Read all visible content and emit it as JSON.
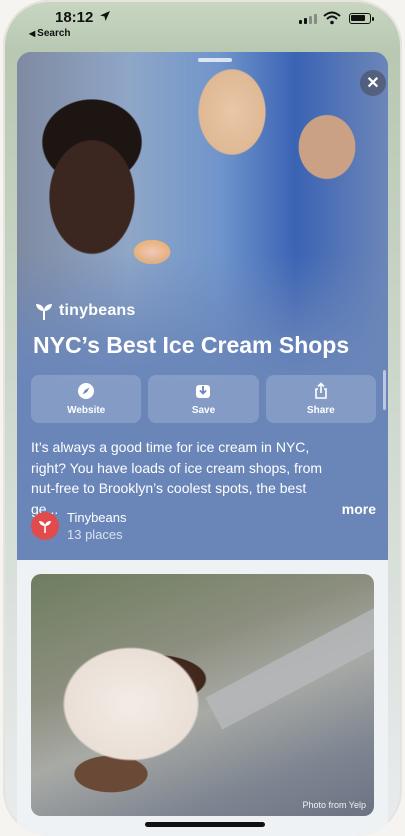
{
  "status_bar": {
    "time": "18:12",
    "back_label": "Search"
  },
  "guide": {
    "brand": "tinybeans",
    "title": "NYC’s Best Ice Cream Shops",
    "actions": [
      {
        "label": "Website",
        "icon": "compass-icon"
      },
      {
        "label": "Save",
        "icon": "download-icon"
      },
      {
        "label": "Share",
        "icon": "share-icon"
      }
    ],
    "description": "It’s always a good time for ice cream in NYC, right? You have loads of ice cream shops, from nut-free to Brooklyn’s coolest spots, the best ge...",
    "more_label": "more",
    "source_name": "Tinybeans",
    "source_count": "13 places"
  },
  "photo": {
    "credit": "Photo from Yelp"
  },
  "colors": {
    "card_bg": "#6a86b9",
    "source_logo": "#e14b4b"
  }
}
